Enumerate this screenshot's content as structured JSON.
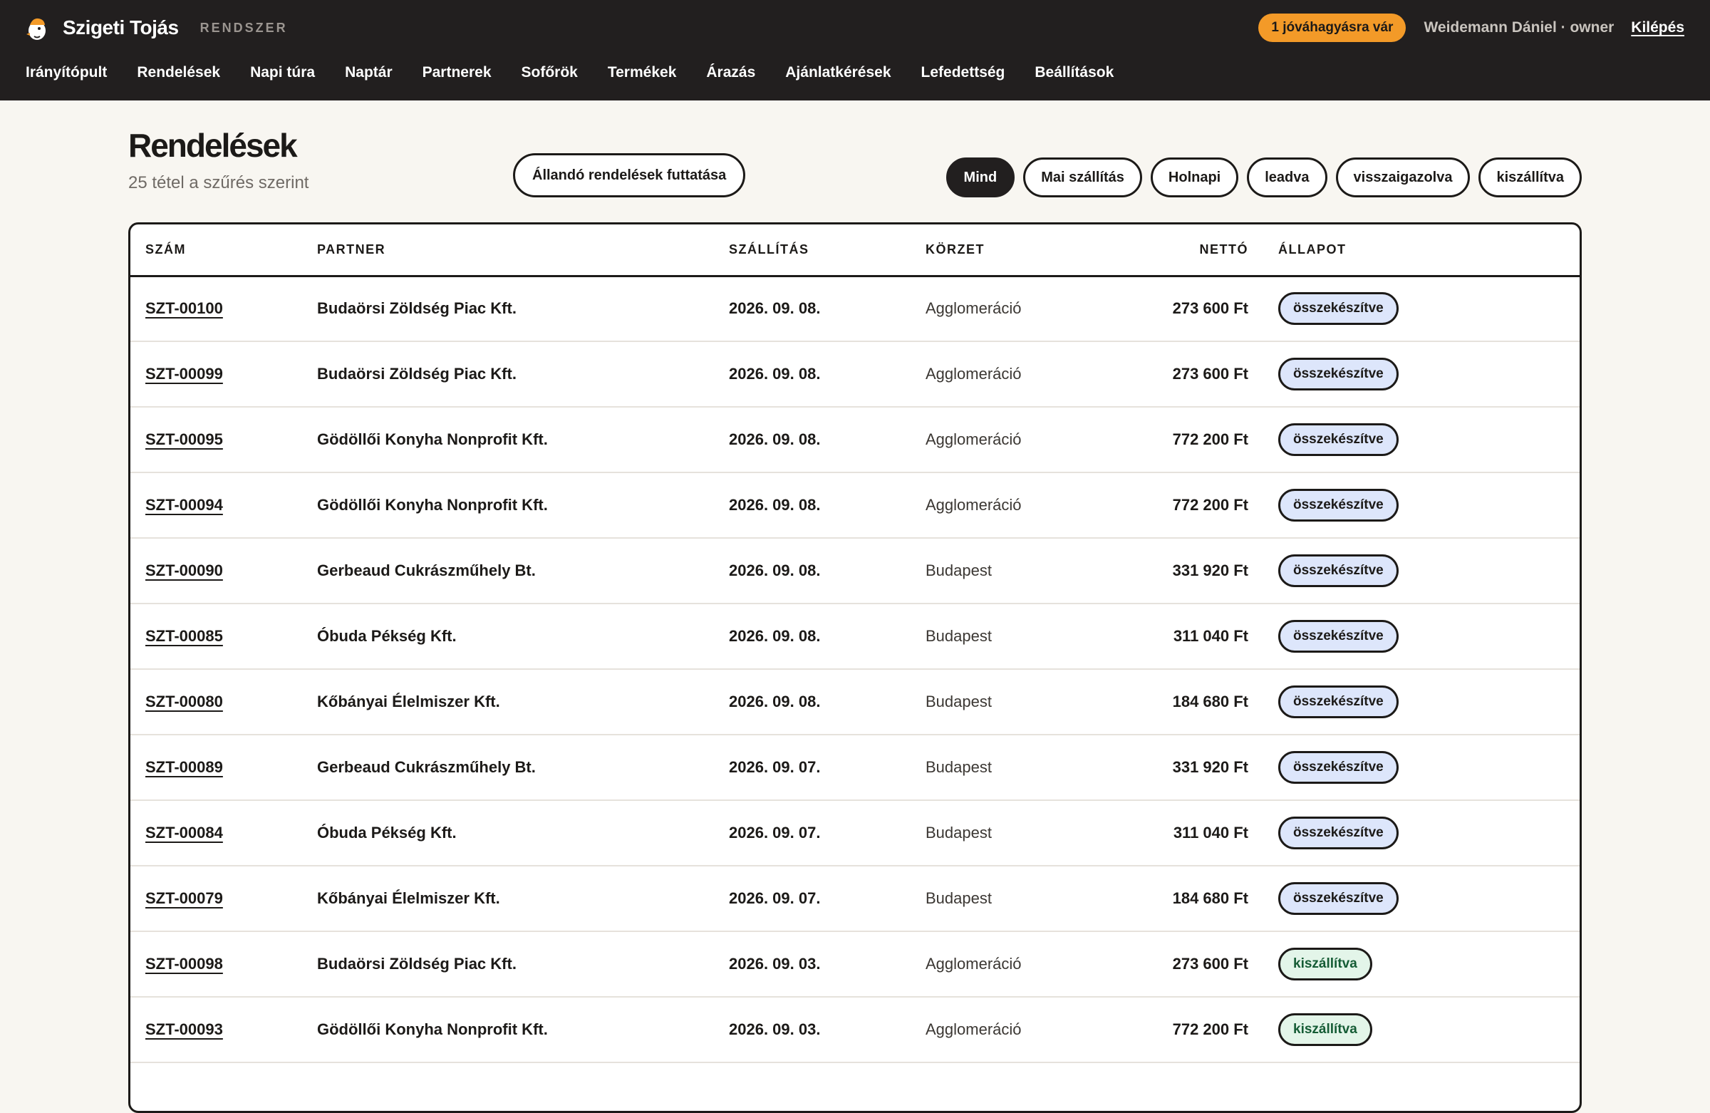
{
  "app": {
    "brand_name": "Szigeti Tojás",
    "brand_sub": "RENDSZER",
    "approval_badge": "1 jóváhagyásra vár",
    "user": "Weidemann Dániel · owner",
    "logout": "Kilépés",
    "colors": {
      "topbar": "#221f1f",
      "accent": "#f39a28",
      "prepared_badge": "#dde6fb",
      "delivered_badge": "#e3f5e9"
    }
  },
  "nav": {
    "items": [
      "Irányítópult",
      "Rendelések",
      "Napi túra",
      "Naptár",
      "Partnerek",
      "Sofőrök",
      "Termékek",
      "Árazás",
      "Ajánlatkérések",
      "Lefedettség",
      "Beállítások"
    ]
  },
  "page": {
    "title": "Rendelések",
    "subtitle": "25 tétel a szűrés szerint",
    "standing_button": "Állandó rendelések futtatása"
  },
  "filters": {
    "active": "Mind",
    "items": [
      "Mind",
      "Mai szállítás",
      "Holnapi",
      "leadva",
      "visszaigazolva",
      "kiszállítva"
    ]
  },
  "table": {
    "headers": [
      "SZÁM",
      "PARTNER",
      "SZÁLLÍTÁS",
      "KÖRZET",
      "NETTÓ",
      "ÁLLAPOT"
    ],
    "rows": [
      {
        "num": "SZT-00100",
        "partner": "Budaörsi Zöldség Piac Kft.",
        "date": "2026. 09. 08.",
        "zone": "Agglomeráció",
        "net": "273 600 Ft",
        "status": "összekészítve",
        "status_type": "prepared"
      },
      {
        "num": "SZT-00099",
        "partner": "Budaörsi Zöldség Piac Kft.",
        "date": "2026. 09. 08.",
        "zone": "Agglomeráció",
        "net": "273 600 Ft",
        "status": "összekészítve",
        "status_type": "prepared"
      },
      {
        "num": "SZT-00095",
        "partner": "Gödöllői Konyha Nonprofit Kft.",
        "date": "2026. 09. 08.",
        "zone": "Agglomeráció",
        "net": "772 200 Ft",
        "status": "összekészítve",
        "status_type": "prepared"
      },
      {
        "num": "SZT-00094",
        "partner": "Gödöllői Konyha Nonprofit Kft.",
        "date": "2026. 09. 08.",
        "zone": "Agglomeráció",
        "net": "772 200 Ft",
        "status": "összekészítve",
        "status_type": "prepared"
      },
      {
        "num": "SZT-00090",
        "partner": "Gerbeaud Cukrászműhely Bt.",
        "date": "2026. 09. 08.",
        "zone": "Budapest",
        "net": "331 920 Ft",
        "status": "összekészítve",
        "status_type": "prepared"
      },
      {
        "num": "SZT-00085",
        "partner": "Óbuda Pékség Kft.",
        "date": "2026. 09. 08.",
        "zone": "Budapest",
        "net": "311 040 Ft",
        "status": "összekészítve",
        "status_type": "prepared"
      },
      {
        "num": "SZT-00080",
        "partner": "Kőbányai Élelmiszer Kft.",
        "date": "2026. 09. 08.",
        "zone": "Budapest",
        "net": "184 680 Ft",
        "status": "összekészítve",
        "status_type": "prepared"
      },
      {
        "num": "SZT-00089",
        "partner": "Gerbeaud Cukrászműhely Bt.",
        "date": "2026. 09. 07.",
        "zone": "Budapest",
        "net": "331 920 Ft",
        "status": "összekészítve",
        "status_type": "prepared"
      },
      {
        "num": "SZT-00084",
        "partner": "Óbuda Pékség Kft.",
        "date": "2026. 09. 07.",
        "zone": "Budapest",
        "net": "311 040 Ft",
        "status": "összekészítve",
        "status_type": "prepared"
      },
      {
        "num": "SZT-00079",
        "partner": "Kőbányai Élelmiszer Kft.",
        "date": "2026. 09. 07.",
        "zone": "Budapest",
        "net": "184 680 Ft",
        "status": "összekészítve",
        "status_type": "prepared"
      },
      {
        "num": "SZT-00098",
        "partner": "Budaörsi Zöldség Piac Kft.",
        "date": "2026. 09. 03.",
        "zone": "Agglomeráció",
        "net": "273 600 Ft",
        "status": "kiszállítva",
        "status_type": "delivered"
      },
      {
        "num": "SZT-00093",
        "partner": "Gödöllői Konyha Nonprofit Kft.",
        "date": "2026. 09. 03.",
        "zone": "Agglomeráció",
        "net": "772 200 Ft",
        "status": "kiszállítva",
        "status_type": "delivered"
      }
    ]
  }
}
